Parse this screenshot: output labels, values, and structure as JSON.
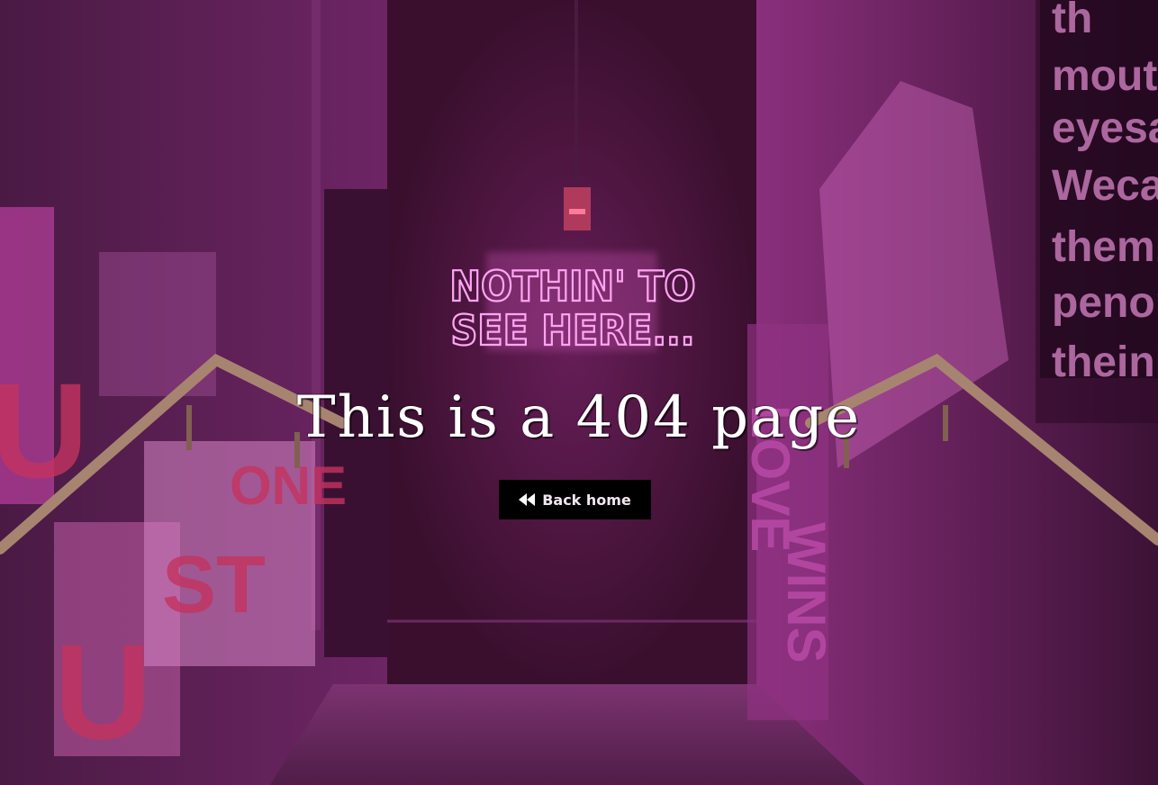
{
  "neon_sign": {
    "line1": "NOTHIN' TO",
    "line2": "SEE HERE..."
  },
  "page": {
    "title": "This is a 404 page"
  },
  "back_button": {
    "label": "Back home",
    "icon": "rewind-icon"
  },
  "wall_posters": {
    "right_top": [
      "th",
      "mouth",
      "eyesa",
      "Wecar",
      "themb",
      "penorr",
      "theink."
    ],
    "right_lower": [
      "LOVE",
      "WINS"
    ],
    "left": [
      "U",
      "U",
      "ST",
      "ONE"
    ]
  },
  "colors": {
    "neon": "#ff9ef0",
    "scene_base": "#2a0e22",
    "wall_magenta": "#8a2f7c",
    "button_bg": "#000000",
    "title_text": "#ffffff"
  }
}
